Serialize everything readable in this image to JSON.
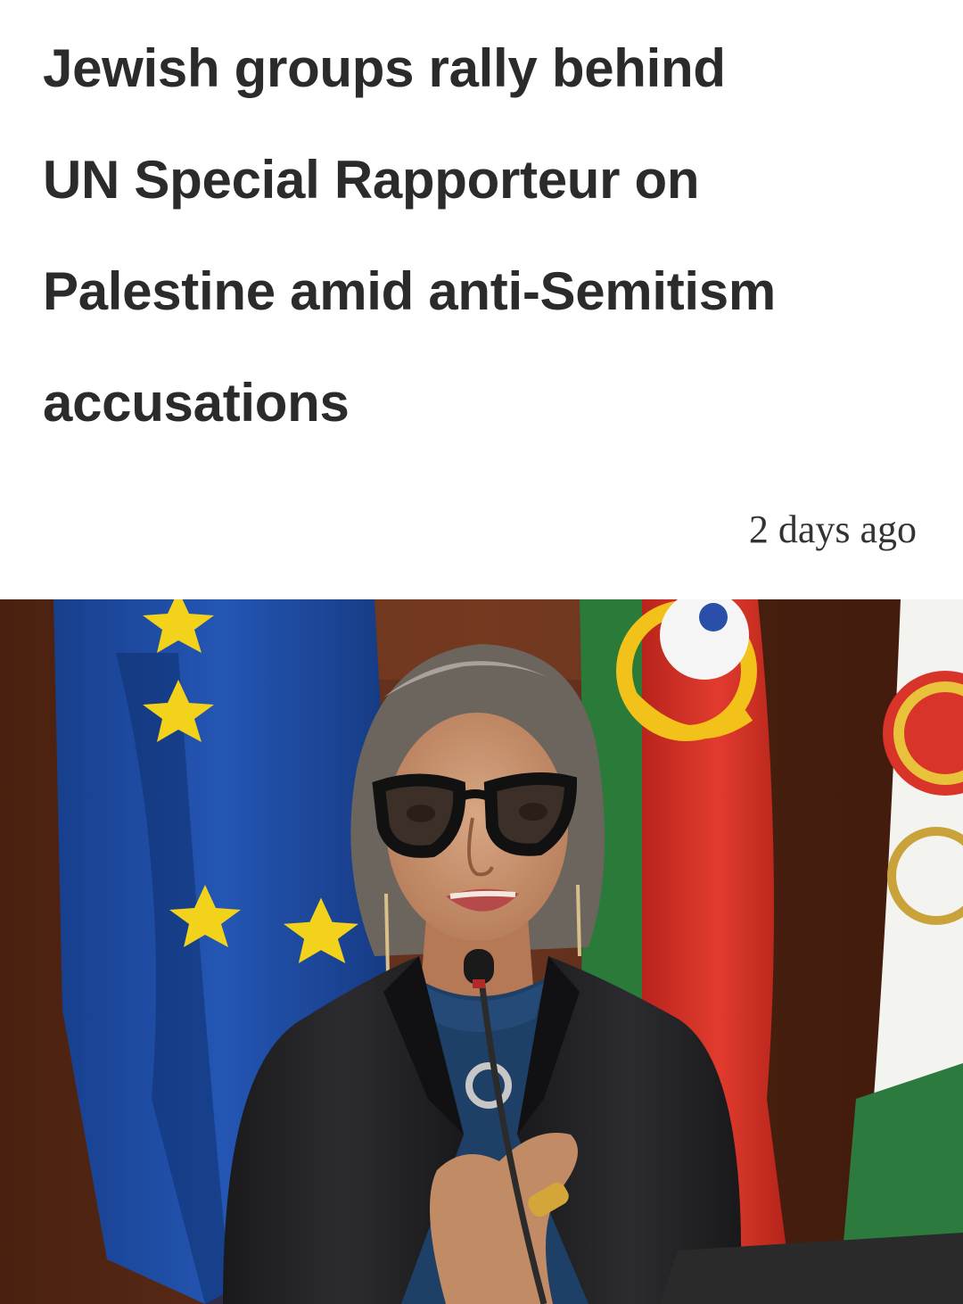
{
  "article": {
    "headline_lines": [
      "Jewish groups rally behind",
      "UN Special Rapporteur on",
      "Palestine amid anti-Semitism",
      "accusations"
    ],
    "timestamp": "2 days ago"
  },
  "hero_image": {
    "alt": "Woman with glasses speaking into a microphone in front of EU, Portuguese and regional flags"
  },
  "colors": {
    "headline_text": "#2b2b2b",
    "timestamp_text": "#333333",
    "eu_blue": "#1f4fa6",
    "eu_star": "#f2d21a",
    "pt_red": "#d8342a",
    "pt_green": "#2a7a3a",
    "wood": "#5b2c16"
  }
}
